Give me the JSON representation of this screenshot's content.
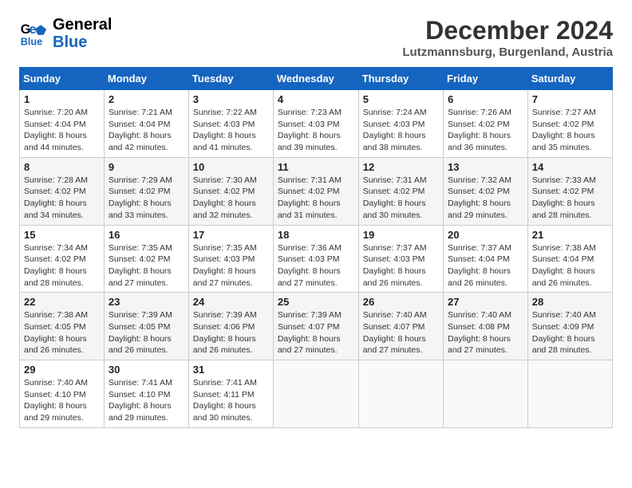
{
  "logo": {
    "text_general": "General",
    "text_blue": "Blue"
  },
  "header": {
    "month": "December 2024",
    "location": "Lutzmannsburg, Burgenland, Austria"
  },
  "weekdays": [
    "Sunday",
    "Monday",
    "Tuesday",
    "Wednesday",
    "Thursday",
    "Friday",
    "Saturday"
  ],
  "weeks": [
    [
      {
        "day": "1",
        "sunrise": "7:20 AM",
        "sunset": "4:04 PM",
        "daylight": "8 hours and 44 minutes."
      },
      {
        "day": "2",
        "sunrise": "7:21 AM",
        "sunset": "4:04 PM",
        "daylight": "8 hours and 42 minutes."
      },
      {
        "day": "3",
        "sunrise": "7:22 AM",
        "sunset": "4:03 PM",
        "daylight": "8 hours and 41 minutes."
      },
      {
        "day": "4",
        "sunrise": "7:23 AM",
        "sunset": "4:03 PM",
        "daylight": "8 hours and 39 minutes."
      },
      {
        "day": "5",
        "sunrise": "7:24 AM",
        "sunset": "4:03 PM",
        "daylight": "8 hours and 38 minutes."
      },
      {
        "day": "6",
        "sunrise": "7:26 AM",
        "sunset": "4:02 PM",
        "daylight": "8 hours and 36 minutes."
      },
      {
        "day": "7",
        "sunrise": "7:27 AM",
        "sunset": "4:02 PM",
        "daylight": "8 hours and 35 minutes."
      }
    ],
    [
      {
        "day": "8",
        "sunrise": "7:28 AM",
        "sunset": "4:02 PM",
        "daylight": "8 hours and 34 minutes."
      },
      {
        "day": "9",
        "sunrise": "7:29 AM",
        "sunset": "4:02 PM",
        "daylight": "8 hours and 33 minutes."
      },
      {
        "day": "10",
        "sunrise": "7:30 AM",
        "sunset": "4:02 PM",
        "daylight": "8 hours and 32 minutes."
      },
      {
        "day": "11",
        "sunrise": "7:31 AM",
        "sunset": "4:02 PM",
        "daylight": "8 hours and 31 minutes."
      },
      {
        "day": "12",
        "sunrise": "7:31 AM",
        "sunset": "4:02 PM",
        "daylight": "8 hours and 30 minutes."
      },
      {
        "day": "13",
        "sunrise": "7:32 AM",
        "sunset": "4:02 PM",
        "daylight": "8 hours and 29 minutes."
      },
      {
        "day": "14",
        "sunrise": "7:33 AM",
        "sunset": "4:02 PM",
        "daylight": "8 hours and 28 minutes."
      }
    ],
    [
      {
        "day": "15",
        "sunrise": "7:34 AM",
        "sunset": "4:02 PM",
        "daylight": "8 hours and 28 minutes."
      },
      {
        "day": "16",
        "sunrise": "7:35 AM",
        "sunset": "4:02 PM",
        "daylight": "8 hours and 27 minutes."
      },
      {
        "day": "17",
        "sunrise": "7:35 AM",
        "sunset": "4:03 PM",
        "daylight": "8 hours and 27 minutes."
      },
      {
        "day": "18",
        "sunrise": "7:36 AM",
        "sunset": "4:03 PM",
        "daylight": "8 hours and 27 minutes."
      },
      {
        "day": "19",
        "sunrise": "7:37 AM",
        "sunset": "4:03 PM",
        "daylight": "8 hours and 26 minutes."
      },
      {
        "day": "20",
        "sunrise": "7:37 AM",
        "sunset": "4:04 PM",
        "daylight": "8 hours and 26 minutes."
      },
      {
        "day": "21",
        "sunrise": "7:38 AM",
        "sunset": "4:04 PM",
        "daylight": "8 hours and 26 minutes."
      }
    ],
    [
      {
        "day": "22",
        "sunrise": "7:38 AM",
        "sunset": "4:05 PM",
        "daylight": "8 hours and 26 minutes."
      },
      {
        "day": "23",
        "sunrise": "7:39 AM",
        "sunset": "4:05 PM",
        "daylight": "8 hours and 26 minutes."
      },
      {
        "day": "24",
        "sunrise": "7:39 AM",
        "sunset": "4:06 PM",
        "daylight": "8 hours and 26 minutes."
      },
      {
        "day": "25",
        "sunrise": "7:39 AM",
        "sunset": "4:07 PM",
        "daylight": "8 hours and 27 minutes."
      },
      {
        "day": "26",
        "sunrise": "7:40 AM",
        "sunset": "4:07 PM",
        "daylight": "8 hours and 27 minutes."
      },
      {
        "day": "27",
        "sunrise": "7:40 AM",
        "sunset": "4:08 PM",
        "daylight": "8 hours and 27 minutes."
      },
      {
        "day": "28",
        "sunrise": "7:40 AM",
        "sunset": "4:09 PM",
        "daylight": "8 hours and 28 minutes."
      }
    ],
    [
      {
        "day": "29",
        "sunrise": "7:40 AM",
        "sunset": "4:10 PM",
        "daylight": "8 hours and 29 minutes."
      },
      {
        "day": "30",
        "sunrise": "7:41 AM",
        "sunset": "4:10 PM",
        "daylight": "8 hours and 29 minutes."
      },
      {
        "day": "31",
        "sunrise": "7:41 AM",
        "sunset": "4:11 PM",
        "daylight": "8 hours and 30 minutes."
      },
      null,
      null,
      null,
      null
    ]
  ]
}
